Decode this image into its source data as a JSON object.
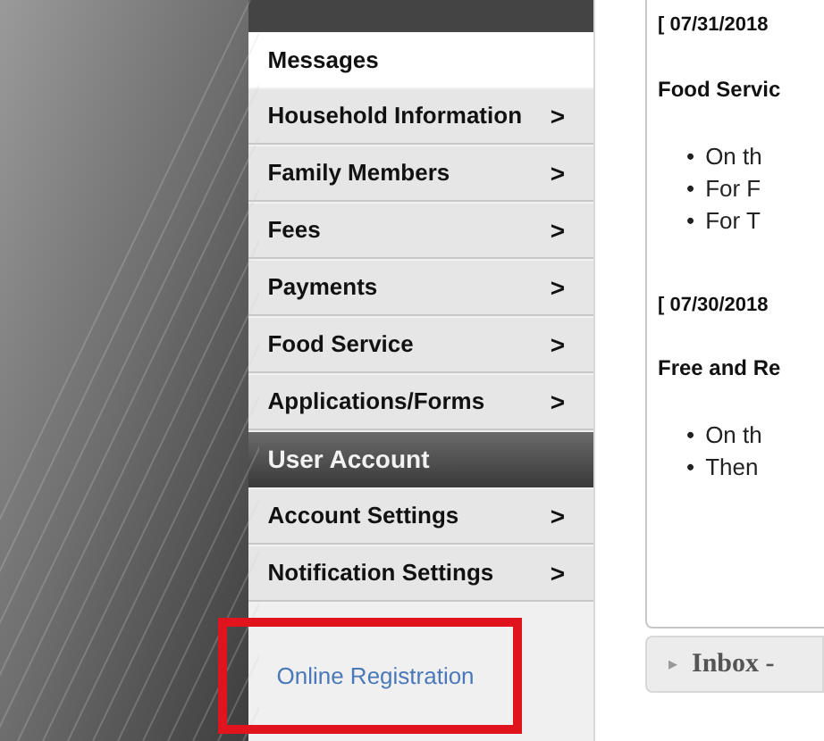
{
  "sidebar": {
    "items": [
      {
        "kind": "item",
        "label": "Messages",
        "selected": true
      },
      {
        "kind": "item",
        "label": "Household Information",
        "selected": false,
        "chevron": ">"
      },
      {
        "kind": "item",
        "label": "Family Members",
        "selected": false,
        "chevron": ">"
      },
      {
        "kind": "item",
        "label": "Fees",
        "selected": false,
        "chevron": ">"
      },
      {
        "kind": "item",
        "label": "Payments",
        "selected": false,
        "chevron": ">"
      },
      {
        "kind": "item",
        "label": "Food Service",
        "selected": false,
        "chevron": ">"
      },
      {
        "kind": "item",
        "label": "Applications/Forms",
        "selected": false,
        "chevron": ">"
      },
      {
        "kind": "header",
        "label": "User Account"
      },
      {
        "kind": "item",
        "label": "Account Settings",
        "selected": false,
        "chevron": ">"
      },
      {
        "kind": "item",
        "label": "Notification Settings",
        "selected": false,
        "chevron": ">"
      }
    ],
    "link": "Online Registration"
  },
  "messages": [
    {
      "date": "[ 07/31/2018",
      "title": "Food Servic",
      "bullets": [
        {
          "mark": "•",
          "text": "On th"
        },
        {
          "mark": "•",
          "text": "For F"
        },
        {
          "mark": "•",
          "text": "For T"
        }
      ]
    },
    {
      "date": "[ 07/30/2018",
      "title": "Free and Re",
      "bullets": [
        {
          "mark": "•",
          "text": "On th"
        },
        {
          "mark": "•",
          "text": "Then"
        }
      ]
    }
  ],
  "inbox_tab": {
    "arrow": "▸",
    "label": "Inbox -"
  }
}
